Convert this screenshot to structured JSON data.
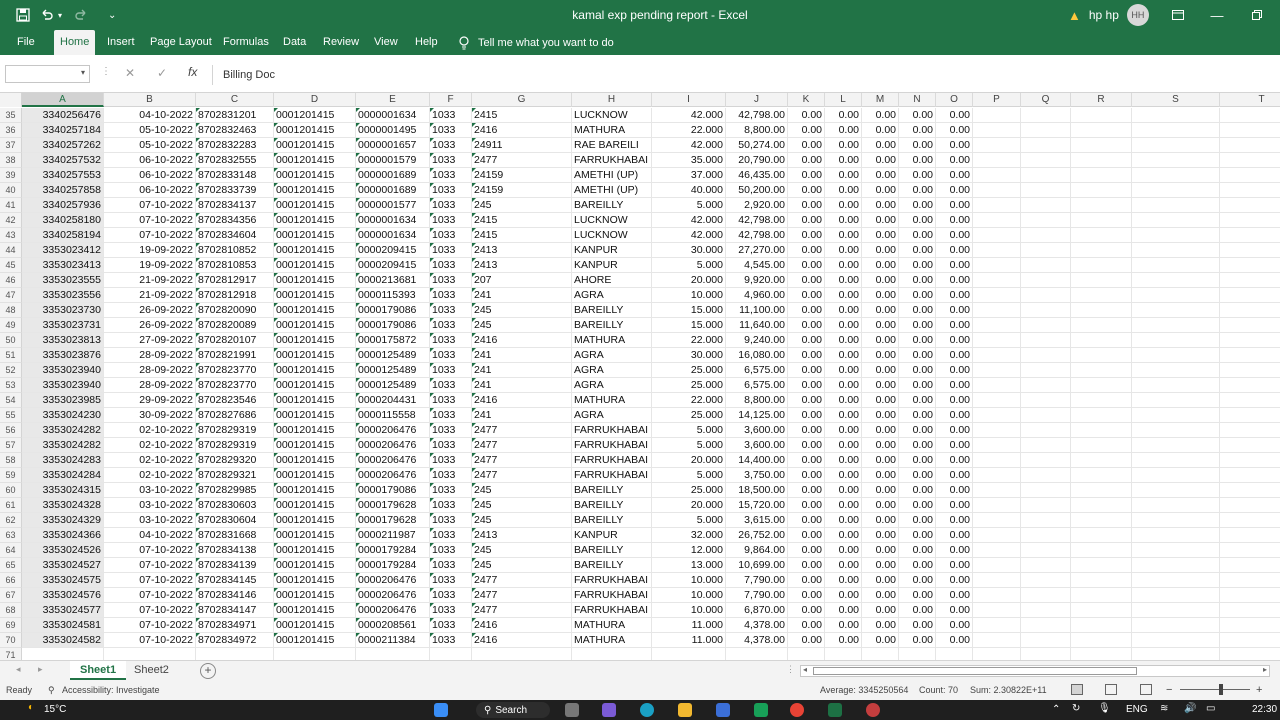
{
  "window": {
    "title": "kamal exp pending report  -  Excel",
    "user_name": "hp hp",
    "user_initials": "HH",
    "qat_more": "⌄"
  },
  "ribbon": {
    "tabs": [
      "File",
      "Home",
      "Insert",
      "Page Layout",
      "Formulas",
      "Data",
      "Review",
      "View",
      "Help"
    ],
    "active_tab": "Home",
    "tell_me": "Tell me what you want to do"
  },
  "formula_bar": {
    "name_box": "",
    "content": "Billing Doc"
  },
  "columns": [
    "A",
    "B",
    "C",
    "D",
    "E",
    "F",
    "G",
    "H",
    "I",
    "J",
    "K",
    "L",
    "M",
    "N",
    "O",
    "P",
    "Q",
    "R",
    "S",
    "T"
  ],
  "selected_column": "A",
  "rows": [
    {
      "n": "35",
      "a": "3340256476",
      "b": "04-10-2022",
      "c": "8702831201",
      "d": "0001201415",
      "e": "0000001634",
      "f": "1033",
      "g": "2415",
      "h": "LUCKNOW",
      "i": "42.000",
      "j": "42,798.00",
      "k": "0.00",
      "l": "0.00",
      "m": "0.00",
      "nn": "0.00",
      "o": "0.00"
    },
    {
      "n": "36",
      "a": "3340257184",
      "b": "05-10-2022",
      "c": "8702832463",
      "d": "0001201415",
      "e": "0000001495",
      "f": "1033",
      "g": "2416",
      "h": "MATHURA",
      "i": "22.000",
      "j": "8,800.00",
      "k": "0.00",
      "l": "0.00",
      "m": "0.00",
      "nn": "0.00",
      "o": "0.00"
    },
    {
      "n": "37",
      "a": "3340257262",
      "b": "05-10-2022",
      "c": "8702832283",
      "d": "0001201415",
      "e": "0000001657",
      "f": "1033",
      "g": "24911",
      "h": "RAE BAREILI",
      "i": "42.000",
      "j": "50,274.00",
      "k": "0.00",
      "l": "0.00",
      "m": "0.00",
      "nn": "0.00",
      "o": "0.00"
    },
    {
      "n": "38",
      "a": "3340257532",
      "b": "06-10-2022",
      "c": "8702832555",
      "d": "0001201415",
      "e": "0000001579",
      "f": "1033",
      "g": "2477",
      "h": "FARRUKHABAI",
      "i": "35.000",
      "j": "20,790.00",
      "k": "0.00",
      "l": "0.00",
      "m": "0.00",
      "nn": "0.00",
      "o": "0.00"
    },
    {
      "n": "39",
      "a": "3340257553",
      "b": "06-10-2022",
      "c": "8702833148",
      "d": "0001201415",
      "e": "0000001689",
      "f": "1033",
      "g": "24159",
      "h": "AMETHI (UP)",
      "i": "37.000",
      "j": "46,435.00",
      "k": "0.00",
      "l": "0.00",
      "m": "0.00",
      "nn": "0.00",
      "o": "0.00"
    },
    {
      "n": "40",
      "a": "3340257858",
      "b": "06-10-2022",
      "c": "8702833739",
      "d": "0001201415",
      "e": "0000001689",
      "f": "1033",
      "g": "24159",
      "h": "AMETHI (UP)",
      "i": "40.000",
      "j": "50,200.00",
      "k": "0.00",
      "l": "0.00",
      "m": "0.00",
      "nn": "0.00",
      "o": "0.00"
    },
    {
      "n": "41",
      "a": "3340257936",
      "b": "07-10-2022",
      "c": "8702834137",
      "d": "0001201415",
      "e": "0000001577",
      "f": "1033",
      "g": "245",
      "h": "BAREILLY",
      "i": "5.000",
      "j": "2,920.00",
      "k": "0.00",
      "l": "0.00",
      "m": "0.00",
      "nn": "0.00",
      "o": "0.00"
    },
    {
      "n": "42",
      "a": "3340258180",
      "b": "07-10-2022",
      "c": "8702834356",
      "d": "0001201415",
      "e": "0000001634",
      "f": "1033",
      "g": "2415",
      "h": "LUCKNOW",
      "i": "42.000",
      "j": "42,798.00",
      "k": "0.00",
      "l": "0.00",
      "m": "0.00",
      "nn": "0.00",
      "o": "0.00"
    },
    {
      "n": "43",
      "a": "3340258194",
      "b": "07-10-2022",
      "c": "8702834604",
      "d": "0001201415",
      "e": "0000001634",
      "f": "1033",
      "g": "2415",
      "h": "LUCKNOW",
      "i": "42.000",
      "j": "42,798.00",
      "k": "0.00",
      "l": "0.00",
      "m": "0.00",
      "nn": "0.00",
      "o": "0.00"
    },
    {
      "n": "44",
      "a": "3353023412",
      "b": "19-09-2022",
      "c": "8702810852",
      "d": "0001201415",
      "e": "0000209415",
      "f": "1033",
      "g": "2413",
      "h": "KANPUR",
      "i": "30.000",
      "j": "27,270.00",
      "k": "0.00",
      "l": "0.00",
      "m": "0.00",
      "nn": "0.00",
      "o": "0.00"
    },
    {
      "n": "45",
      "a": "3353023413",
      "b": "19-09-2022",
      "c": "8702810853",
      "d": "0001201415",
      "e": "0000209415",
      "f": "1033",
      "g": "2413",
      "h": "KANPUR",
      "i": "5.000",
      "j": "4,545.00",
      "k": "0.00",
      "l": "0.00",
      "m": "0.00",
      "nn": "0.00",
      "o": "0.00"
    },
    {
      "n": "46",
      "a": "3353023555",
      "b": "21-09-2022",
      "c": "8702812917",
      "d": "0001201415",
      "e": "0000213681",
      "f": "1033",
      "g": "207",
      "h": "AHORE",
      "i": "20.000",
      "j": "9,920.00",
      "k": "0.00",
      "l": "0.00",
      "m": "0.00",
      "nn": "0.00",
      "o": "0.00"
    },
    {
      "n": "47",
      "a": "3353023556",
      "b": "21-09-2022",
      "c": "8702812918",
      "d": "0001201415",
      "e": "0000115393",
      "f": "1033",
      "g": "241",
      "h": "AGRA",
      "i": "10.000",
      "j": "4,960.00",
      "k": "0.00",
      "l": "0.00",
      "m": "0.00",
      "nn": "0.00",
      "o": "0.00"
    },
    {
      "n": "48",
      "a": "3353023730",
      "b": "26-09-2022",
      "c": "8702820090",
      "d": "0001201415",
      "e": "0000179086",
      "f": "1033",
      "g": "245",
      "h": "BAREILLY",
      "i": "15.000",
      "j": "11,100.00",
      "k": "0.00",
      "l": "0.00",
      "m": "0.00",
      "nn": "0.00",
      "o": "0.00"
    },
    {
      "n": "49",
      "a": "3353023731",
      "b": "26-09-2022",
      "c": "8702820089",
      "d": "0001201415",
      "e": "0000179086",
      "f": "1033",
      "g": "245",
      "h": "BAREILLY",
      "i": "15.000",
      "j": "11,640.00",
      "k": "0.00",
      "l": "0.00",
      "m": "0.00",
      "nn": "0.00",
      "o": "0.00"
    },
    {
      "n": "50",
      "a": "3353023813",
      "b": "27-09-2022",
      "c": "8702820107",
      "d": "0001201415",
      "e": "0000175872",
      "f": "1033",
      "g": "2416",
      "h": "MATHURA",
      "i": "22.000",
      "j": "9,240.00",
      "k": "0.00",
      "l": "0.00",
      "m": "0.00",
      "nn": "0.00",
      "o": "0.00"
    },
    {
      "n": "51",
      "a": "3353023876",
      "b": "28-09-2022",
      "c": "8702821991",
      "d": "0001201415",
      "e": "0000125489",
      "f": "1033",
      "g": "241",
      "h": "AGRA",
      "i": "30.000",
      "j": "16,080.00",
      "k": "0.00",
      "l": "0.00",
      "m": "0.00",
      "nn": "0.00",
      "o": "0.00"
    },
    {
      "n": "52",
      "a": "3353023940",
      "b": "28-09-2022",
      "c": "8702823770",
      "d": "0001201415",
      "e": "0000125489",
      "f": "1033",
      "g": "241",
      "h": "AGRA",
      "i": "25.000",
      "j": "6,575.00",
      "k": "0.00",
      "l": "0.00",
      "m": "0.00",
      "nn": "0.00",
      "o": "0.00"
    },
    {
      "n": "53",
      "a": "3353023940",
      "b": "28-09-2022",
      "c": "8702823770",
      "d": "0001201415",
      "e": "0000125489",
      "f": "1033",
      "g": "241",
      "h": "AGRA",
      "i": "25.000",
      "j": "6,575.00",
      "k": "0.00",
      "l": "0.00",
      "m": "0.00",
      "nn": "0.00",
      "o": "0.00"
    },
    {
      "n": "54",
      "a": "3353023985",
      "b": "29-09-2022",
      "c": "8702823546",
      "d": "0001201415",
      "e": "0000204431",
      "f": "1033",
      "g": "2416",
      "h": "MATHURA",
      "i": "22.000",
      "j": "8,800.00",
      "k": "0.00",
      "l": "0.00",
      "m": "0.00",
      "nn": "0.00",
      "o": "0.00"
    },
    {
      "n": "55",
      "a": "3353024230",
      "b": "30-09-2022",
      "c": "8702827686",
      "d": "0001201415",
      "e": "0000115558",
      "f": "1033",
      "g": "241",
      "h": "AGRA",
      "i": "25.000",
      "j": "14,125.00",
      "k": "0.00",
      "l": "0.00",
      "m": "0.00",
      "nn": "0.00",
      "o": "0.00"
    },
    {
      "n": "56",
      "a": "3353024282",
      "b": "02-10-2022",
      "c": "8702829319",
      "d": "0001201415",
      "e": "0000206476",
      "f": "1033",
      "g": "2477",
      "h": "FARRUKHABAI",
      "i": "5.000",
      "j": "3,600.00",
      "k": "0.00",
      "l": "0.00",
      "m": "0.00",
      "nn": "0.00",
      "o": "0.00"
    },
    {
      "n": "57",
      "a": "3353024282",
      "b": "02-10-2022",
      "c": "8702829319",
      "d": "0001201415",
      "e": "0000206476",
      "f": "1033",
      "g": "2477",
      "h": "FARRUKHABAI",
      "i": "5.000",
      "j": "3,600.00",
      "k": "0.00",
      "l": "0.00",
      "m": "0.00",
      "nn": "0.00",
      "o": "0.00"
    },
    {
      "n": "58",
      "a": "3353024283",
      "b": "02-10-2022",
      "c": "8702829320",
      "d": "0001201415",
      "e": "0000206476",
      "f": "1033",
      "g": "2477",
      "h": "FARRUKHABAI",
      "i": "20.000",
      "j": "14,400.00",
      "k": "0.00",
      "l": "0.00",
      "m": "0.00",
      "nn": "0.00",
      "o": "0.00"
    },
    {
      "n": "59",
      "a": "3353024284",
      "b": "02-10-2022",
      "c": "8702829321",
      "d": "0001201415",
      "e": "0000206476",
      "f": "1033",
      "g": "2477",
      "h": "FARRUKHABAI",
      "i": "5.000",
      "j": "3,750.00",
      "k": "0.00",
      "l": "0.00",
      "m": "0.00",
      "nn": "0.00",
      "o": "0.00"
    },
    {
      "n": "60",
      "a": "3353024315",
      "b": "03-10-2022",
      "c": "8702829985",
      "d": "0001201415",
      "e": "0000179086",
      "f": "1033",
      "g": "245",
      "h": "BAREILLY",
      "i": "25.000",
      "j": "18,500.00",
      "k": "0.00",
      "l": "0.00",
      "m": "0.00",
      "nn": "0.00",
      "o": "0.00"
    },
    {
      "n": "61",
      "a": "3353024328",
      "b": "03-10-2022",
      "c": "8702830603",
      "d": "0001201415",
      "e": "0000179628",
      "f": "1033",
      "g": "245",
      "h": "BAREILLY",
      "i": "20.000",
      "j": "15,720.00",
      "k": "0.00",
      "l": "0.00",
      "m": "0.00",
      "nn": "0.00",
      "o": "0.00"
    },
    {
      "n": "62",
      "a": "3353024329",
      "b": "03-10-2022",
      "c": "8702830604",
      "d": "0001201415",
      "e": "0000179628",
      "f": "1033",
      "g": "245",
      "h": "BAREILLY",
      "i": "5.000",
      "j": "3,615.00",
      "k": "0.00",
      "l": "0.00",
      "m": "0.00",
      "nn": "0.00",
      "o": "0.00"
    },
    {
      "n": "63",
      "a": "3353024366",
      "b": "04-10-2022",
      "c": "8702831668",
      "d": "0001201415",
      "e": "0000211987",
      "f": "1033",
      "g": "2413",
      "h": "KANPUR",
      "i": "32.000",
      "j": "26,752.00",
      "k": "0.00",
      "l": "0.00",
      "m": "0.00",
      "nn": "0.00",
      "o": "0.00"
    },
    {
      "n": "64",
      "a": "3353024526",
      "b": "07-10-2022",
      "c": "8702834138",
      "d": "0001201415",
      "e": "0000179284",
      "f": "1033",
      "g": "245",
      "h": "BAREILLY",
      "i": "12.000",
      "j": "9,864.00",
      "k": "0.00",
      "l": "0.00",
      "m": "0.00",
      "nn": "0.00",
      "o": "0.00"
    },
    {
      "n": "65",
      "a": "3353024527",
      "b": "07-10-2022",
      "c": "8702834139",
      "d": "0001201415",
      "e": "0000179284",
      "f": "1033",
      "g": "245",
      "h": "BAREILLY",
      "i": "13.000",
      "j": "10,699.00",
      "k": "0.00",
      "l": "0.00",
      "m": "0.00",
      "nn": "0.00",
      "o": "0.00"
    },
    {
      "n": "66",
      "a": "3353024575",
      "b": "07-10-2022",
      "c": "8702834145",
      "d": "0001201415",
      "e": "0000206476",
      "f": "1033",
      "g": "2477",
      "h": "FARRUKHABAI",
      "i": "10.000",
      "j": "7,790.00",
      "k": "0.00",
      "l": "0.00",
      "m": "0.00",
      "nn": "0.00",
      "o": "0.00"
    },
    {
      "n": "67",
      "a": "3353024576",
      "b": "07-10-2022",
      "c": "8702834146",
      "d": "0001201415",
      "e": "0000206476",
      "f": "1033",
      "g": "2477",
      "h": "FARRUKHABAI",
      "i": "10.000",
      "j": "7,790.00",
      "k": "0.00",
      "l": "0.00",
      "m": "0.00",
      "nn": "0.00",
      "o": "0.00"
    },
    {
      "n": "68",
      "a": "3353024577",
      "b": "07-10-2022",
      "c": "8702834147",
      "d": "0001201415",
      "e": "0000206476",
      "f": "1033",
      "g": "2477",
      "h": "FARRUKHABAI",
      "i": "10.000",
      "j": "6,870.00",
      "k": "0.00",
      "l": "0.00",
      "m": "0.00",
      "nn": "0.00",
      "o": "0.00"
    },
    {
      "n": "69",
      "a": "3353024581",
      "b": "07-10-2022",
      "c": "8702834971",
      "d": "0001201415",
      "e": "0000208561",
      "f": "1033",
      "g": "2416",
      "h": "MATHURA",
      "i": "11.000",
      "j": "4,378.00",
      "k": "0.00",
      "l": "0.00",
      "m": "0.00",
      "nn": "0.00",
      "o": "0.00"
    },
    {
      "n": "70",
      "a": "3353024582",
      "b": "07-10-2022",
      "c": "8702834972",
      "d": "0001201415",
      "e": "0000211384",
      "f": "1033",
      "g": "2416",
      "h": "MATHURA",
      "i": "11.000",
      "j": "4,378.00",
      "k": "0.00",
      "l": "0.00",
      "m": "0.00",
      "nn": "0.00",
      "o": "0.00"
    },
    {
      "n": "71",
      "a": "",
      "b": "",
      "c": "",
      "d": "",
      "e": "",
      "f": "",
      "g": "",
      "h": "",
      "i": "",
      "j": "",
      "k": "",
      "l": "",
      "m": "",
      "nn": "",
      "o": ""
    }
  ],
  "sheets": [
    "Sheet1",
    "Sheet2"
  ],
  "active_sheet": "Sheet1",
  "status": {
    "ready": "Ready",
    "accessibility": "Accessibility: Investigate",
    "average": "Average: 3345250564",
    "count": "Count: 70",
    "sum": "Sum: 2.30822E+11"
  },
  "taskbar": {
    "weather": "15°C",
    "search": "Search",
    "lang": "ENG",
    "time": "22:30"
  },
  "colors": {
    "excel_green": "#217346",
    "tri": "#1e7145"
  }
}
